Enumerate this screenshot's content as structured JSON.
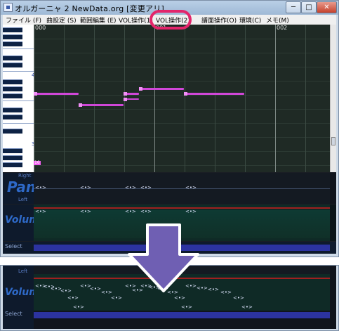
{
  "window": {
    "title": "オルガーニャ 2  NewData.org [変更アリ]",
    "min_label": "─",
    "max_label": "□",
    "close_label": "✕"
  },
  "menu": [
    {
      "label": "ファイル (F)"
    },
    {
      "label": "曲設定 (S)"
    },
    {
      "label": "範囲編集 (E)"
    },
    {
      "label": "VOL操作(1)"
    },
    {
      "label": "VOL操作(2)"
    },
    {
      "label": "譜面操作(O)"
    },
    {
      "label": "環境(C)"
    },
    {
      "label": "メモ(M)"
    }
  ],
  "editor": {
    "measures": [
      "000",
      "001",
      "002"
    ],
    "octave_labels": [
      "4",
      "3"
    ],
    "note_marker": "16"
  },
  "pan": {
    "label": "Pan",
    "right": "Right",
    "left": "Left"
  },
  "volume": {
    "label": "Volume"
  },
  "select": {
    "label": "Select"
  },
  "bottom": {
    "left": "Left",
    "volume": "Volume",
    "select": "Select"
  },
  "marker_glyph": "<•>",
  "colors": {
    "highlight": "#e3256b",
    "note": "#d047d8",
    "arrow": "#6f5fb3"
  }
}
